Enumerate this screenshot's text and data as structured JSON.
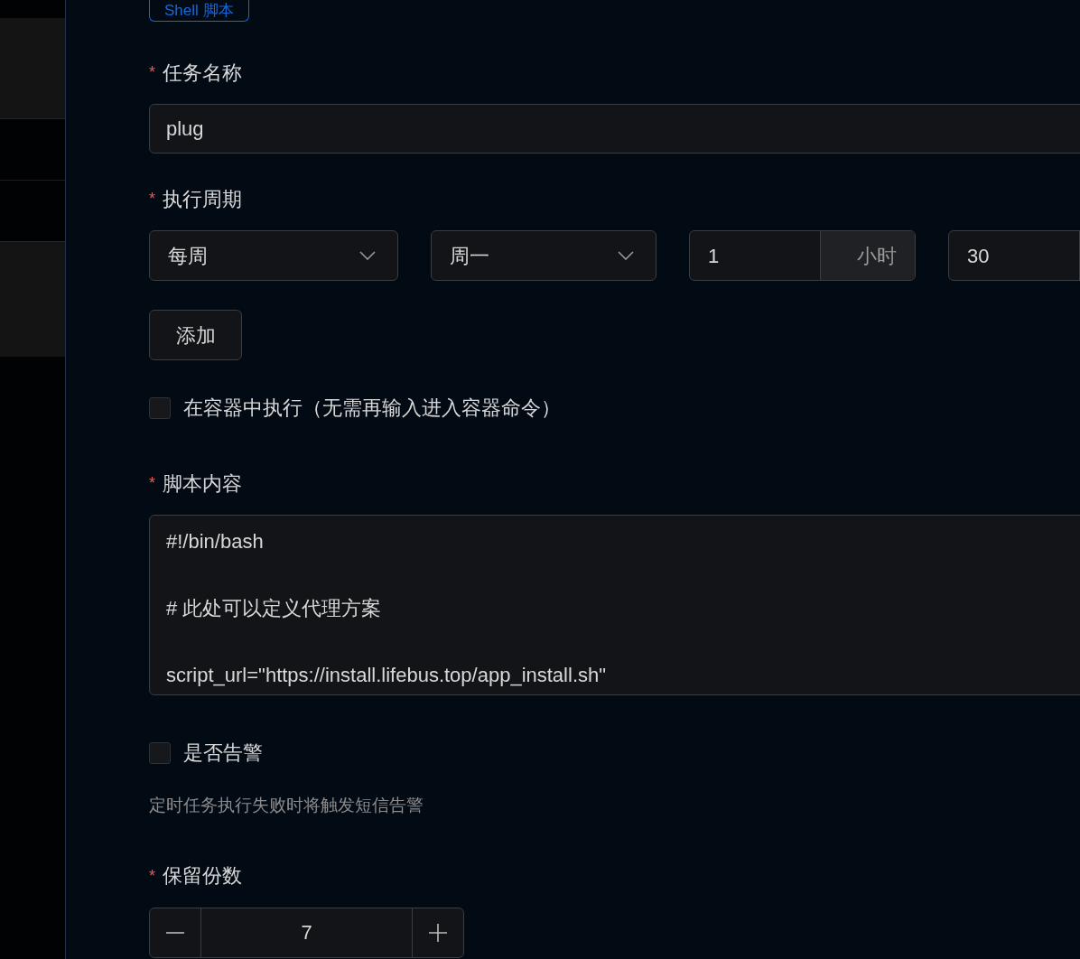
{
  "script_type": {
    "label": "Shell 脚本",
    "selected": true
  },
  "task_name": {
    "label": "任务名称",
    "mark": "*",
    "value": "plug"
  },
  "schedule": {
    "label": "执行周期",
    "mark": "*",
    "period": "每周",
    "weekday": "周一",
    "hour": {
      "value": "1",
      "unit": "小时"
    },
    "minute": {
      "value": "30"
    }
  },
  "add_button": "添加",
  "run_in_container": {
    "label": "在容器中执行（无需再输入进入容器命令）",
    "checked": false
  },
  "script_content": {
    "label": "脚本内容",
    "mark": "*",
    "paragraphs": [
      "#!/bin/bash",
      "# 此处可以定义代理方案",
      "script_url=\"https://install.lifebus.top/app_install.sh\""
    ]
  },
  "alert": {
    "label": "是否告警",
    "checked": false,
    "hint": "定时任务执行失败时将触发短信告警"
  },
  "retain_copies": {
    "label": "保留份数",
    "mark": "*",
    "value": "7"
  }
}
